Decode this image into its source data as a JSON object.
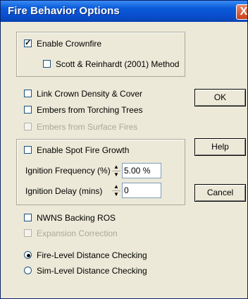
{
  "window": {
    "title": "Fire Behavior Options",
    "close_glyph": "X"
  },
  "crownfire_group": {
    "enable_crownfire": {
      "label": "Enable Crownfire",
      "checked": true
    },
    "scott_reinhardt": {
      "label": "Scott & Reinhardt (2001) Method",
      "checked": false
    }
  },
  "options": {
    "link_crown_density": {
      "label": "Link Crown Density & Cover",
      "checked": false
    },
    "embers_torching": {
      "label": "Embers from Torching Trees",
      "checked": false
    },
    "embers_surface": {
      "label": "Embers from Surface Fires",
      "checked": false,
      "disabled": true
    }
  },
  "spot_fire_group": {
    "enable_spot_fire": {
      "label": "Enable Spot Fire Growth",
      "checked": false
    },
    "ignition_frequency": {
      "label": "Ignition Frequency (%)",
      "value": "5.00 %"
    },
    "ignition_delay": {
      "label": "Ignition Delay (mins)",
      "value": "0"
    }
  },
  "nwns": {
    "backing_ros": {
      "label": "NWNS Backing ROS",
      "checked": false
    },
    "expansion_correction": {
      "label": "Expansion Correction",
      "checked": false,
      "disabled": true
    }
  },
  "distance_checking": {
    "fire_level": {
      "label": "Fire-Level Distance Checking",
      "selected": true
    },
    "sim_level": {
      "label": "Sim-Level Distance Checking",
      "selected": false
    }
  },
  "buttons": {
    "ok": "OK",
    "help": "Help",
    "cancel": "Cancel"
  },
  "icons": {
    "check": "✓",
    "spin_up": "▲",
    "spin_down": "▼"
  },
  "colors": {
    "title_bar": "#0b5bd8",
    "dialog_bg": "#ece9d8",
    "close_button": "#c9401d"
  }
}
